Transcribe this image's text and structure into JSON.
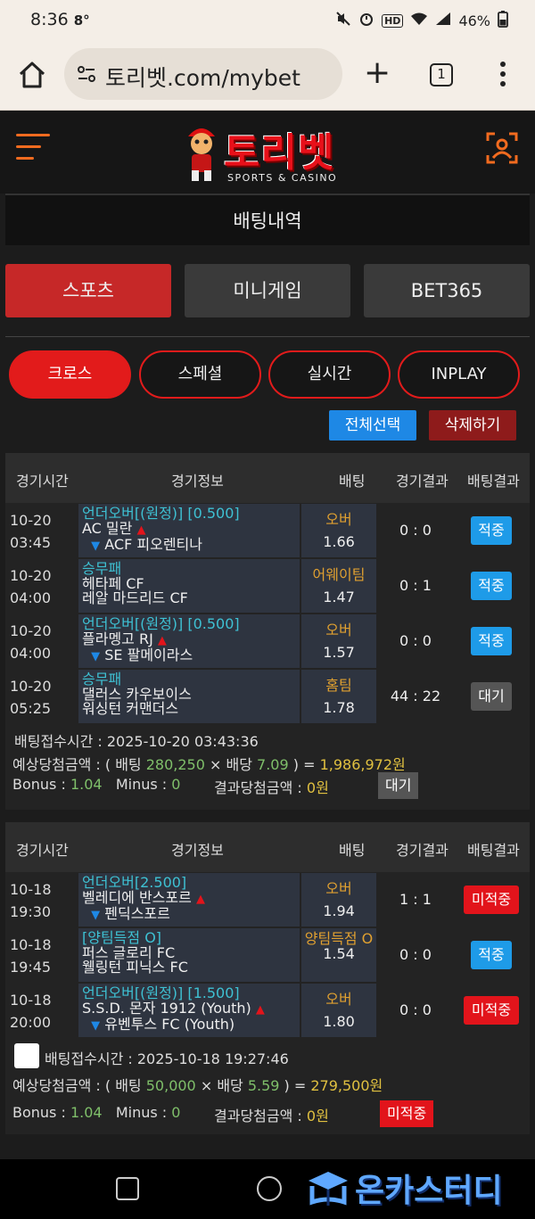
{
  "status": {
    "time": "8:36",
    "extra": "8°",
    "battery": "46%"
  },
  "browser": {
    "url": "토리벳.com/mybet",
    "tab_count": "1"
  },
  "site": {
    "logo_text": "토리벳",
    "logo_sub": "SPORTS & CASINO"
  },
  "page_title": "배팅내역",
  "main_tabs": [
    "스포츠",
    "미니게임",
    "BET365"
  ],
  "sub_tabs": [
    "크로스",
    "스페셜",
    "실시간",
    "INPLAY"
  ],
  "actions": {
    "select_all": "전체선택",
    "delete": "삭제하기"
  },
  "headers": [
    "경기시간",
    "경기정보",
    "배팅",
    "경기결과",
    "배팅결과"
  ],
  "bets": [
    {
      "rows": [
        {
          "date": "10-20",
          "time": "03:45",
          "type": "언더오버[(원정)] [0.500]",
          "home": "AC 밀란",
          "home_mark": "▲",
          "away_mark": "▼",
          "away": "ACF 피오렌티나",
          "pick": "오버",
          "odds": "1.66",
          "score": "0 : 0",
          "result": "적중"
        },
        {
          "date": "10-20",
          "time": "04:00",
          "type": "승무패",
          "home": "헤타페 CF",
          "home_mark": "",
          "away_mark": "",
          "away": "레알 마드리드 CF",
          "pick": "어웨이팀",
          "odds": "1.47",
          "score": "0 : 1",
          "result": "적중"
        },
        {
          "date": "10-20",
          "time": "04:00",
          "type": "언더오버[(원정)] [0.500]",
          "home": "플라멩고 RJ",
          "home_mark": "▲",
          "away_mark": "▼",
          "away": "SE 팔메이라스",
          "pick": "오버",
          "odds": "1.57",
          "score": "0 : 0",
          "result": "적중"
        },
        {
          "date": "10-20",
          "time": "05:25",
          "type": "승무패",
          "home": "댈러스 카우보이스",
          "home_mark": "",
          "away_mark": "",
          "away": "워싱턴 커맨더스",
          "pick": "홈팀",
          "odds": "1.78",
          "score": "44 : 22",
          "result": "대기"
        }
      ],
      "accept_label": "배팅접수시간 : 2025-10-20 03:43:36",
      "expected_prefix": "예상당첨금액 : ( 배팅 ",
      "stake": "280,250",
      "times": " × 배당 ",
      "multiplier": "7.09",
      "expected_suffix": " ) = ",
      "payout": "1,986,972원",
      "bonus_label": "Bonus : ",
      "bonus": "1.04",
      "minus_label": "Minus : ",
      "minus": "0",
      "result_amount_label": "결과당첨금액 : ",
      "result_amount": "0원",
      "status": "대기"
    },
    {
      "rows": [
        {
          "date": "10-18",
          "time": "19:30",
          "type": "언더오버[2.500]",
          "home": "벨레디에 반스포르",
          "home_mark": "▲",
          "away_mark": "▼",
          "away": "펜딕스포르",
          "pick": "오버",
          "odds": "1.94",
          "score": "1 : 1",
          "result": "미적중"
        },
        {
          "date": "10-18",
          "time": "19:45",
          "type": "[양팀득점 O]",
          "home": "퍼스 글로리 FC",
          "home_mark": "",
          "away_mark": "",
          "away": "웰링턴 피닉스 FC",
          "pick": "양팀득점 O",
          "odds": "1.54",
          "score": "0 : 0",
          "result": "적중"
        },
        {
          "date": "10-18",
          "time": "20:00",
          "type": "언더오버[(원정)] [1.500]",
          "home": "S.S.D. 몬자 1912 (Youth)",
          "home_mark": "▲",
          "away_mark": "▼",
          "away": "유벤투스 FC (Youth)",
          "pick": "오버",
          "odds": "1.80",
          "score": "0 : 0",
          "result": "미적중"
        }
      ],
      "accept_label": "배팅접수시간 : 2025-10-18 19:27:46",
      "expected_prefix": "예상당첨금액 : ( 배팅 ",
      "stake": "50,000",
      "times": " × 배당 ",
      "multiplier": "5.59",
      "expected_suffix": " ) = ",
      "payout": "279,500원",
      "bonus_label": "Bonus : ",
      "bonus": "1.04",
      "minus_label": "Minus : ",
      "minus": "0",
      "result_amount_label": "결과당첨금액 : ",
      "result_amount": "0원",
      "status": "미적중"
    }
  ],
  "watermark": "온카스터디",
  "colors": {
    "accent_red": "#e21b1b",
    "win_blue": "#1e9be8",
    "type_cyan": "#3ec1d3",
    "pick_orange": "#e0a030"
  }
}
